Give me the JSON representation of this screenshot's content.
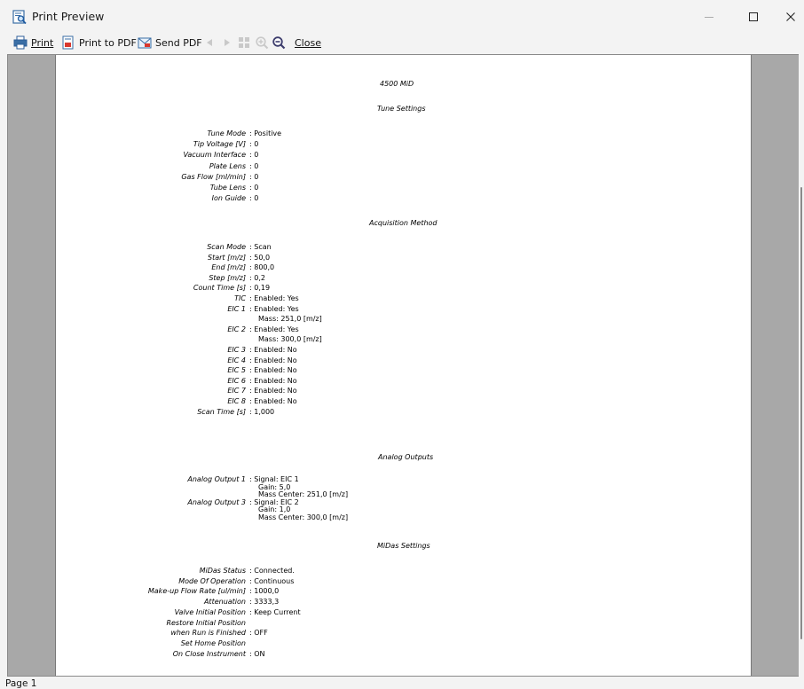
{
  "window": {
    "title": "Print Preview"
  },
  "toolbar": {
    "print": "Print",
    "print_pdf": "Print to PDF",
    "send_pdf": "Send PDF",
    "close": "Close"
  },
  "doc": {
    "header": "4500 MiD",
    "sections": {
      "tune": "Tune Settings",
      "acq": "Acquisition Method",
      "analog": "Analog Outputs",
      "midas": "MiDas Settings"
    },
    "tune_rows": [
      {
        "label": "Tune Mode",
        "value": ": Positive"
      },
      {
        "label": "Tip Voltage [V]",
        "value": ": 0"
      },
      {
        "label": "Vacuum Interface",
        "value": ": 0"
      },
      {
        "label": "Plate Lens",
        "value": ": 0"
      },
      {
        "label": "Gas Flow [ml/min]",
        "value": ": 0"
      },
      {
        "label": "Tube Lens",
        "value": ": 0"
      },
      {
        "label": "Ion Guide",
        "value": ": 0"
      }
    ],
    "acq_rows": [
      {
        "label": "Scan Mode",
        "value": ": Scan"
      },
      {
        "label": "Start [m/z]",
        "value": ": 50,0"
      },
      {
        "label": "End [m/z]",
        "value": ": 800,0"
      },
      {
        "label": "Step [m/z]",
        "value": ": 0,2"
      },
      {
        "label": "Count Time [s]",
        "value": ": 0,19"
      },
      {
        "label": "TIC",
        "value": ": Enabled: Yes"
      },
      {
        "label": "EIC 1",
        "value": ": Enabled: Yes"
      },
      {
        "label": "",
        "value": "Mass: 251,0  [m/z]"
      },
      {
        "label": "EIC 2",
        "value": ": Enabled: Yes"
      },
      {
        "label": "",
        "value": "Mass: 300,0  [m/z]"
      },
      {
        "label": "EIC 3",
        "value": ": Enabled: No"
      },
      {
        "label": "EIC 4",
        "value": ": Enabled: No"
      },
      {
        "label": "EIC 5",
        "value": ": Enabled: No"
      },
      {
        "label": "EIC 6",
        "value": ": Enabled: No"
      },
      {
        "label": "EIC 7",
        "value": ": Enabled: No"
      },
      {
        "label": "EIC 8",
        "value": ": Enabled: No"
      },
      {
        "label": "Scan Time [s]",
        "value": ": 1,000"
      }
    ],
    "analog_rows": [
      {
        "label": "Analog Output 1",
        "value": ": Signal:  EIC 1"
      },
      {
        "label": "",
        "value": "Gain: 5,0"
      },
      {
        "label": "",
        "value": "Mass Center: 251,0  [m/z]"
      },
      {
        "label": "Analog Output 3",
        "value": ": Signal:  EIC 2"
      },
      {
        "label": "",
        "value": "Gain: 1,0"
      },
      {
        "label": "",
        "value": "Mass Center: 300,0  [m/z]"
      }
    ],
    "midas_rows": [
      {
        "label": "MiDas Status",
        "value": ": Connected."
      },
      {
        "label": "Mode Of Operation",
        "value": ": Continuous"
      },
      {
        "label": "Make-up Flow Rate [ul/min]",
        "value": ": 1000,0"
      },
      {
        "label": "Attenuation",
        "value": ": 3333,3"
      },
      {
        "label": "Valve Initial Position",
        "value": ": Keep Current"
      },
      {
        "label": "Restore Initial Position",
        "value": ""
      },
      {
        "label": "when Run is Finished",
        "value": ": OFF"
      },
      {
        "label": "Set Home Position",
        "value": ""
      },
      {
        "label": "On Close Instrument",
        "value": ": ON"
      }
    ]
  },
  "status": {
    "page": "Page 1"
  }
}
